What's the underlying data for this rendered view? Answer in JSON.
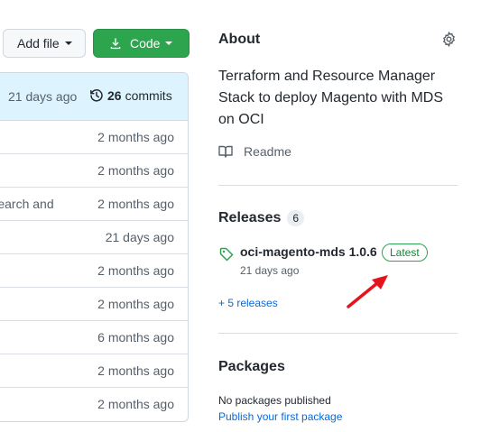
{
  "toolbar": {
    "add_file_label": "Add file",
    "code_label": "Code",
    "code_color": "#2da44e"
  },
  "latest_commit": {
    "age": "21 days ago",
    "commit_count": "26",
    "commits_label": "commits"
  },
  "files": [
    {
      "message": "",
      "age": "2 months ago"
    },
    {
      "message": "",
      "age": "2 months ago"
    },
    {
      "message": "Search and",
      "age": "2 months ago"
    },
    {
      "message": "",
      "age": "21 days ago"
    },
    {
      "message": "",
      "age": "2 months ago"
    },
    {
      "message": "",
      "age": "2 months ago"
    },
    {
      "message": "",
      "age": "6 months ago"
    },
    {
      "message": "",
      "age": "2 months ago"
    },
    {
      "message": "",
      "age": "2 months ago"
    }
  ],
  "about": {
    "title": "About",
    "description": "Terraform and Resource Manager Stack to deploy Magento with MDS on OCI",
    "readme_label": "Readme",
    "settings_icon": "gear-icon"
  },
  "releases": {
    "title": "Releases",
    "count": "6",
    "latest_name": "oci-magento-mds 1.0.6",
    "latest_badge": "Latest",
    "latest_date": "21 days ago",
    "more_link": "+ 5 releases",
    "badge_color": "#2da44e"
  },
  "packages": {
    "title": "Packages",
    "empty_text": "No packages published",
    "publish_link": "Publish your first package"
  },
  "annotation": {
    "arrow_color": "#e3141b"
  }
}
